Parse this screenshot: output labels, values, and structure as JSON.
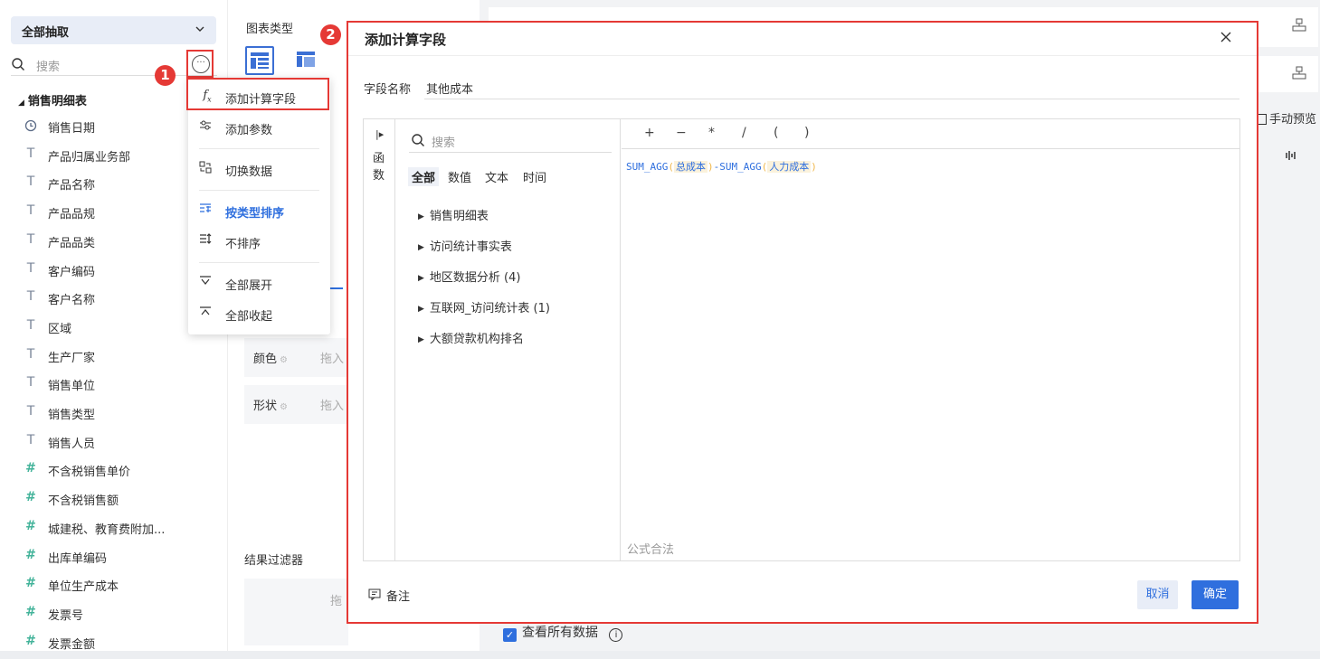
{
  "left_panel": {
    "datasource_select": "全部抽取",
    "search_placeholder": "搜索",
    "table_title": "销售明细表",
    "fields": [
      {
        "icon": "clock-icon",
        "type": "date",
        "label": "销售日期"
      },
      {
        "icon": "text-type-icon",
        "type": "text",
        "label": "产品归属业务部"
      },
      {
        "icon": "text-type-icon",
        "type": "text",
        "label": "产品名称"
      },
      {
        "icon": "text-type-icon",
        "type": "text",
        "label": "产品品规"
      },
      {
        "icon": "text-type-icon",
        "type": "text",
        "label": "产品品类"
      },
      {
        "icon": "text-type-icon",
        "type": "text",
        "label": "客户编码"
      },
      {
        "icon": "text-type-icon",
        "type": "text",
        "label": "客户名称"
      },
      {
        "icon": "text-type-icon",
        "type": "text",
        "label": "区域"
      },
      {
        "icon": "text-type-icon",
        "type": "text",
        "label": "生产厂家"
      },
      {
        "icon": "text-type-icon",
        "type": "text",
        "label": "销售单位"
      },
      {
        "icon": "text-type-icon",
        "type": "text",
        "label": "销售类型"
      },
      {
        "icon": "text-type-icon",
        "type": "text",
        "label": "销售人员"
      },
      {
        "icon": "number-type-icon",
        "type": "number",
        "label": "不含税销售单价"
      },
      {
        "icon": "number-type-icon",
        "type": "number",
        "label": "不含税销售额"
      },
      {
        "icon": "number-type-icon",
        "type": "number",
        "label": "城建税、教育费附加..."
      },
      {
        "icon": "number-type-icon",
        "type": "number",
        "label": "出库单编码"
      },
      {
        "icon": "number-type-icon",
        "type": "number",
        "label": "单位生产成本"
      },
      {
        "icon": "number-type-icon",
        "type": "number",
        "label": "发票号"
      },
      {
        "icon": "number-type-icon",
        "type": "number",
        "label": "发票金额"
      }
    ]
  },
  "middle_panel": {
    "chart_type_label": "图表类型",
    "color_label": "颜色",
    "shape_label": "形状",
    "drop_hint": "拖入",
    "result_filter_label": "结果过滤器",
    "filter_drop_hint": "拖"
  },
  "right_area": {
    "manual_preview": "手动预览",
    "view_all_data": "查看所有数据"
  },
  "more_menu": {
    "items": [
      {
        "icon": "fx-icon",
        "label": "添加计算字段"
      },
      {
        "icon": "param-slider-icon",
        "label": "添加参数"
      },
      {
        "icon": "switch-data-icon",
        "label": "切换数据"
      },
      {
        "icon": "sort-by-type-icon",
        "label": "按类型排序",
        "active": true
      },
      {
        "icon": "no-sort-icon",
        "label": "不排序"
      },
      {
        "icon": "expand-all-icon",
        "label": "全部展开"
      },
      {
        "icon": "collapse-all-icon",
        "label": "全部收起"
      }
    ]
  },
  "badges": {
    "step1": "1",
    "step2": "2"
  },
  "dialog": {
    "title": "添加计算字段",
    "field_name_label": "字段名称",
    "field_name_value": "其他成本",
    "function_strip_label": "函数",
    "search_placeholder": "搜索",
    "filter_tabs": [
      "全部",
      "数值",
      "文本",
      "时间"
    ],
    "tree_nodes": [
      "销售明细表",
      "访问统计事实表",
      "地区数据分析 (4)",
      "互联网_访问统计表 (1)",
      "大额贷款机构排名"
    ],
    "operators": [
      "+",
      "−",
      "*",
      "/",
      "(",
      ")"
    ],
    "formula": {
      "fn1": "SUM_AGG",
      "arg1": "总成本",
      "minus": "-",
      "fn2": "SUM_AGG",
      "arg2": "人力成本",
      "open": "(",
      "close": ")"
    },
    "validity": "公式合法",
    "note_label": "备注",
    "cancel_label": "取消",
    "ok_label": "确定"
  },
  "colors": {
    "accent": "#2f6fde",
    "highlight": "#e53935"
  }
}
